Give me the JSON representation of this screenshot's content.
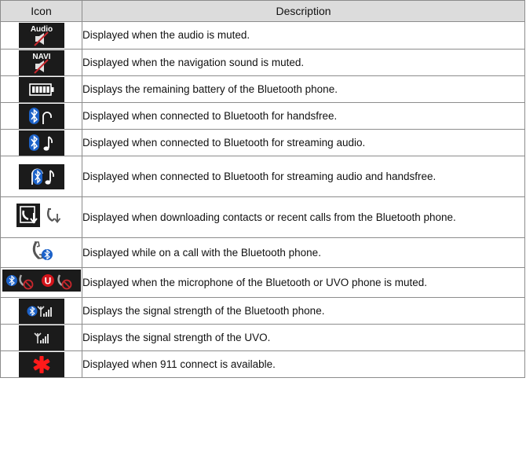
{
  "header": {
    "icon": "Icon",
    "description": "Description"
  },
  "rows": [
    {
      "icon": "audio-mute-icon",
      "label": "Audio",
      "description": "Displayed when the audio is muted."
    },
    {
      "icon": "navi-mute-icon",
      "label": "NAVI",
      "description": "Displayed when the navigation sound is muted."
    },
    {
      "icon": "battery-icon",
      "description": "Displays the remaining battery of the Bluetooth phone."
    },
    {
      "icon": "bluetooth-handsfree-icon",
      "description": "Displayed when connected to Bluetooth for handsfree."
    },
    {
      "icon": "bluetooth-streaming-icon",
      "description": "Displayed when connected to Bluetooth for streaming audio."
    },
    {
      "icon": "bluetooth-streaming-handsfree-icon",
      "description": "Displayed when connected to Bluetooth for streaming audio and handsfree."
    },
    {
      "icon": "download-contacts-icon",
      "description": "Displayed when downloading contacts or recent calls from the Bluetooth phone."
    },
    {
      "icon": "bluetooth-call-icon",
      "description": "Displayed while on a call with the Bluetooth phone."
    },
    {
      "icon": "mic-muted-icon",
      "uvo_letter": "U",
      "description": "Displayed when the microphone of the Bluetooth or UVO phone is muted."
    },
    {
      "icon": "bluetooth-signal-icon",
      "description": "Displays the signal strength of the Bluetooth phone."
    },
    {
      "icon": "uvo-signal-icon",
      "description": "Displays the signal strength of the UVO."
    },
    {
      "icon": "911-connect-icon",
      "description": "Displayed when 911 connect is available."
    }
  ],
  "colors": {
    "icon_bg": "#1b1b1b",
    "bluetooth_blue": "#1c62c9",
    "uvo_red": "#d3141b",
    "mute_red": "#c8272d",
    "header_bg": "#dcdcdc"
  }
}
